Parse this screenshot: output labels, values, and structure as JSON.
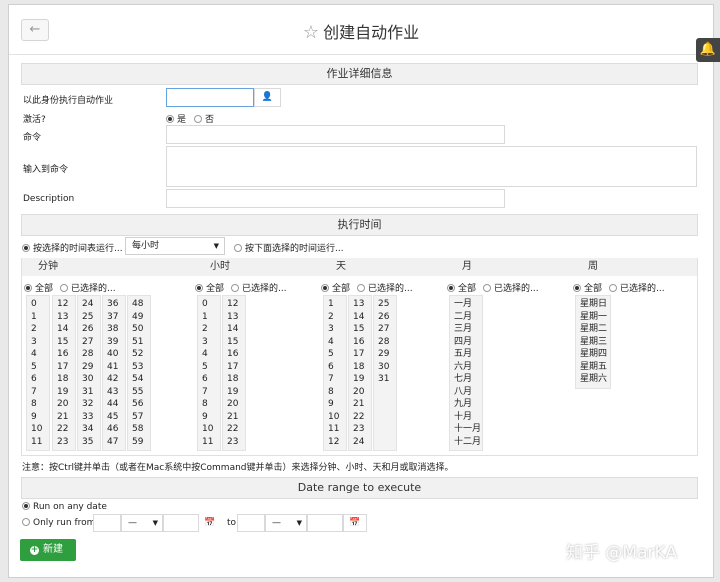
{
  "header": {
    "title": "创建自动作业",
    "back_icon": "arrow-left-icon",
    "star_icon": "star-icon"
  },
  "details": {
    "section_title": "作业详细信息",
    "run_as_label": "以此身份执行自动作业",
    "active_label": "激活?",
    "active_yes": "是",
    "active_no": "否",
    "command_label": "命令",
    "input_label": "输入到命令",
    "description_label": "Description"
  },
  "schedule": {
    "section_title": "执行时间",
    "opt_by_schedule": "按选择的时间表运行...",
    "schedule_value": "每小时",
    "opt_by_selection": "按下面选择的时间运行...",
    "columns": [
      {
        "title": "分钟",
        "all": "全部",
        "selected": "已选择的..."
      },
      {
        "title": "小时",
        "all": "全部",
        "selected": "已选择的..."
      },
      {
        "title": "天",
        "all": "全部",
        "selected": "已选择的..."
      },
      {
        "title": "月",
        "all": "全部",
        "selected": "已选择的..."
      },
      {
        "title": "周",
        "all": "全部",
        "selected": "已选择的..."
      }
    ],
    "minutes": [
      [
        "0",
        "1",
        "2",
        "3",
        "4",
        "5",
        "6",
        "7",
        "8",
        "9",
        "10",
        "11"
      ],
      [
        "12",
        "13",
        "14",
        "15",
        "16",
        "17",
        "18",
        "19",
        "20",
        "21",
        "22",
        "23"
      ],
      [
        "24",
        "25",
        "26",
        "27",
        "28",
        "29",
        "30",
        "31",
        "32",
        "33",
        "34",
        "35"
      ],
      [
        "36",
        "37",
        "38",
        "39",
        "40",
        "41",
        "42",
        "43",
        "44",
        "45",
        "46",
        "47"
      ],
      [
        "48",
        "49",
        "50",
        "51",
        "52",
        "53",
        "54",
        "55",
        "56",
        "57",
        "58",
        "59"
      ]
    ],
    "hours": [
      [
        "0",
        "1",
        "2",
        "3",
        "4",
        "5",
        "6",
        "7",
        "8",
        "9",
        "10",
        "11"
      ],
      [
        "12",
        "13",
        "14",
        "15",
        "16",
        "17",
        "18",
        "19",
        "20",
        "21",
        "22",
        "23"
      ]
    ],
    "days": [
      [
        "1",
        "2",
        "3",
        "4",
        "5",
        "6",
        "7",
        "8",
        "9",
        "10",
        "11",
        "12"
      ],
      [
        "13",
        "14",
        "15",
        "16",
        "17",
        "18",
        "19",
        "20",
        "21",
        "22",
        "23",
        "24"
      ],
      [
        "25",
        "26",
        "27",
        "28",
        "29",
        "30",
        "31"
      ]
    ],
    "months": [
      "一月",
      "二月",
      "三月",
      "四月",
      "五月",
      "六月",
      "七月",
      "八月",
      "九月",
      "十月",
      "十一月",
      "十二月"
    ],
    "weekdays": [
      "星期日",
      "星期一",
      "星期二",
      "星期三",
      "星期四",
      "星期五",
      "星期六"
    ],
    "note": "注意：按Ctrl键并单击（或者在Mac系统中按Command键并单击）来选择分钟、小时、天和月或取消选择。"
  },
  "date_range": {
    "section_title": "Date range to execute",
    "opt_any": "Run on any date",
    "opt_only": "Only run from",
    "dash": "—",
    "to": "to"
  },
  "actions": {
    "new_label": "新建"
  },
  "watermark": "知乎 @MarKA"
}
